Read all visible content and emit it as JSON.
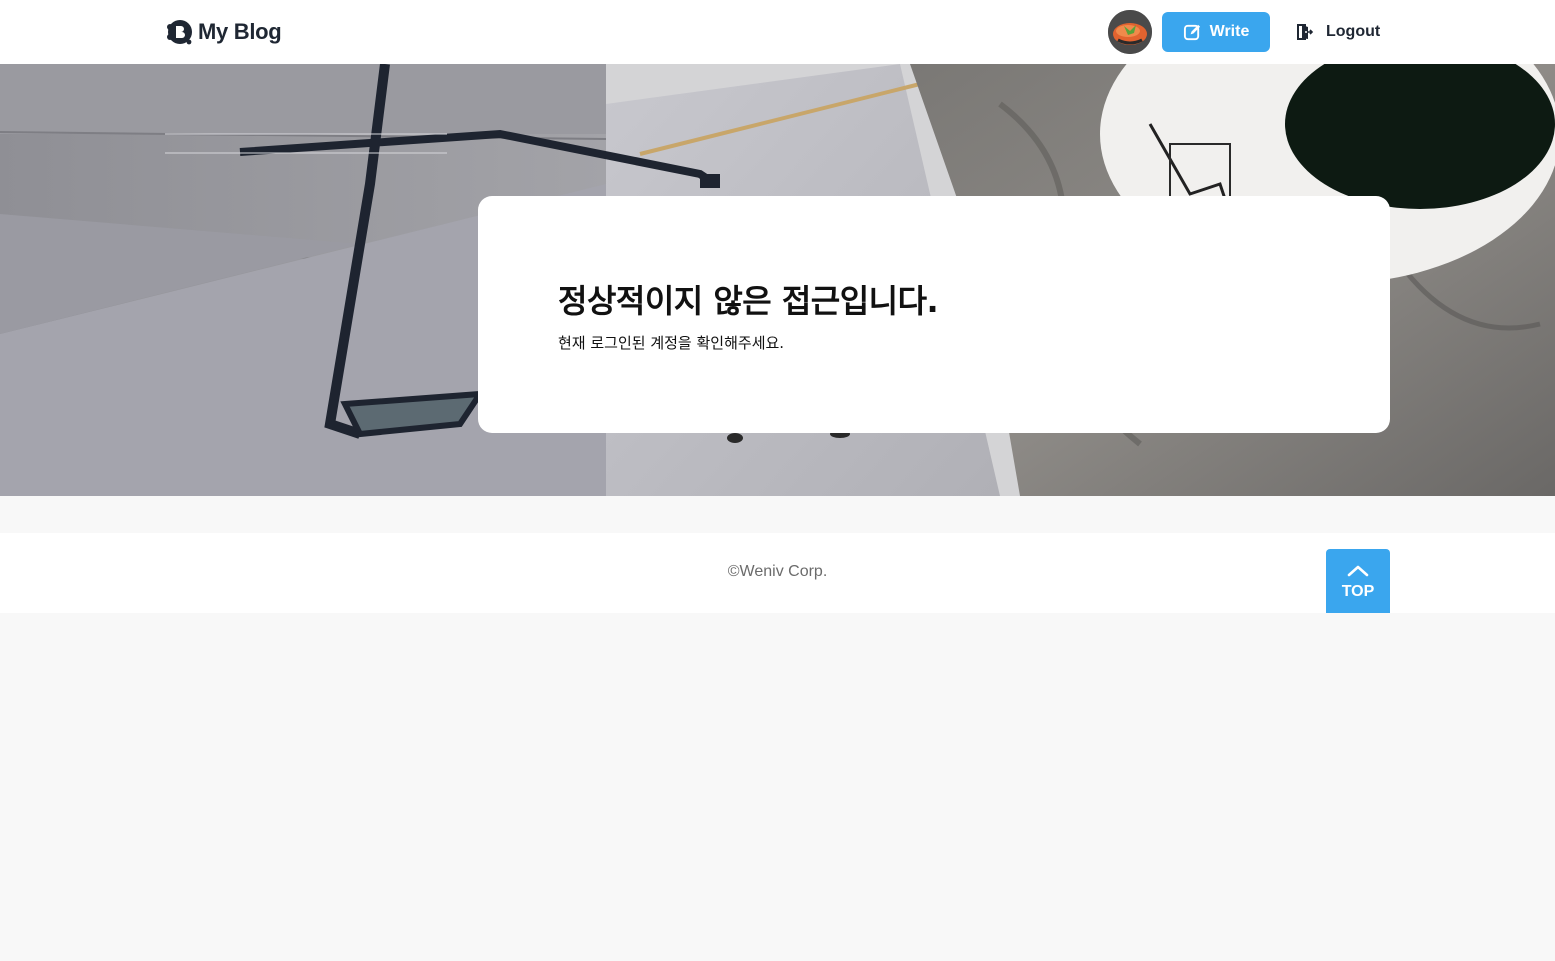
{
  "header": {
    "logo_text": "My Blog",
    "write_label": "Write",
    "logout_label": "Logout"
  },
  "notice": {
    "title": "정상적이지 않은 접근입니다.",
    "message": "현재 로그인된 계정을 확인해주세요."
  },
  "footer": {
    "copyright": "©Weniv Corp.",
    "top_label": "TOP"
  },
  "colors": {
    "accent": "#3aa6ee",
    "text_dark": "#1f2733",
    "background": "#f8f8f8"
  },
  "icons": {
    "logo": "blog-logo-icon",
    "write": "pencil-square-icon",
    "logout": "logout-door-icon",
    "top": "chevron-up-icon"
  }
}
